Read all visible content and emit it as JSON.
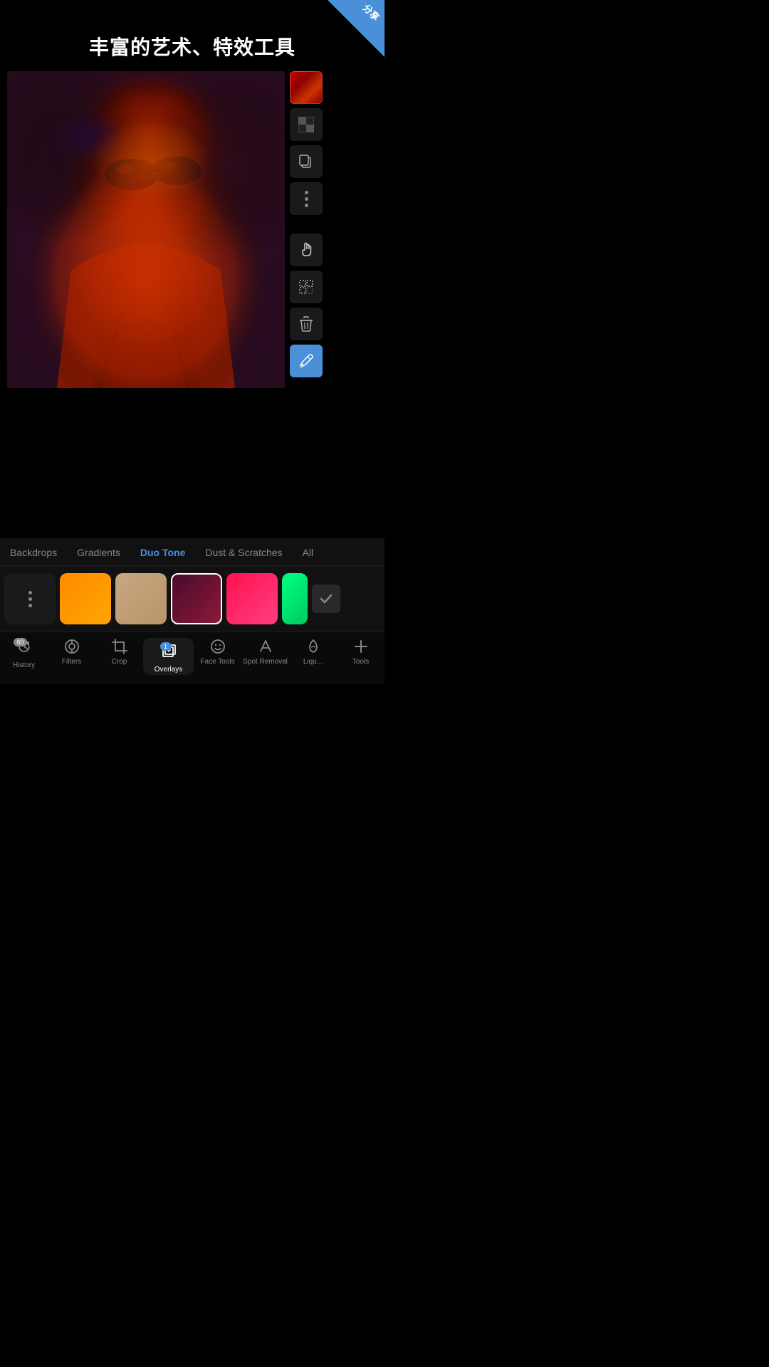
{
  "app": {
    "title": "丰富的艺术、特效工具",
    "corner_badge": "分享"
  },
  "toolbar": {
    "color_swatch_label": "color swatch red",
    "checker_label": "checker pattern",
    "copy_label": "copy layer",
    "more_label": "more options",
    "hand_label": "hand tool",
    "select_label": "select tool",
    "delete_label": "delete",
    "eyedropper_label": "eyedropper"
  },
  "categories": [
    {
      "id": "backdrops",
      "label": "Backdrops",
      "active": false
    },
    {
      "id": "gradients",
      "label": "Gradients",
      "active": false
    },
    {
      "id": "duo-tone",
      "label": "Duo Tone",
      "active": true
    },
    {
      "id": "dust-scratches",
      "label": "Dust & Scratches",
      "active": false
    },
    {
      "id": "all",
      "label": "All",
      "active": false
    }
  ],
  "swatches": [
    {
      "id": "dots",
      "type": "dots"
    },
    {
      "id": "orange",
      "colors": [
        "#FF8C00",
        "#FFA500"
      ]
    },
    {
      "id": "tan",
      "colors": [
        "#C8A882",
        "#B8956A"
      ]
    },
    {
      "id": "dark-red",
      "colors": [
        "#4a0a2a",
        "#8B1a3a"
      ],
      "active": true
    },
    {
      "id": "pink-red",
      "colors": [
        "#FF1050",
        "#FF4080"
      ]
    },
    {
      "id": "green-teal",
      "colors": [
        "#00FF80",
        "#00CC60"
      ]
    }
  ],
  "bottom_nav": [
    {
      "id": "history",
      "label": "History",
      "icon": "history",
      "badge": "60"
    },
    {
      "id": "filters",
      "label": "Filters",
      "icon": "filters"
    },
    {
      "id": "crop",
      "label": "Crop",
      "icon": "crop"
    },
    {
      "id": "overlays",
      "label": "Overlays",
      "icon": "overlays",
      "active": true,
      "badge": "1"
    },
    {
      "id": "face-tools",
      "label": "Face Tools",
      "icon": "face"
    },
    {
      "id": "spot-removal",
      "label": "Spot Removal",
      "icon": "spot"
    },
    {
      "id": "liquify",
      "label": "Liqu...",
      "icon": "liquify"
    },
    {
      "id": "tools",
      "label": "Tools",
      "icon": "plus"
    }
  ]
}
